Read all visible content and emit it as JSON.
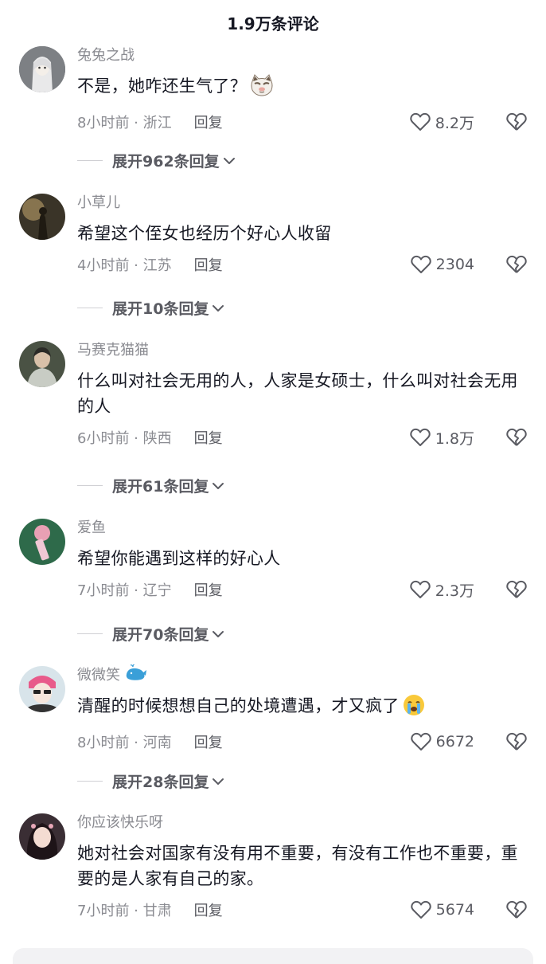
{
  "header": {
    "title": "1.9万条评论"
  },
  "comments": [
    {
      "username": "兔兔之战",
      "text": "不是，她咋还生气了？",
      "emoji": "cat-face-emoji",
      "time_location": "8小时前 · 浙江",
      "reply_label": "回复",
      "likes": "8.2万",
      "expand_label": "展开962条回复"
    },
    {
      "username": "小草儿",
      "text": "希望这个侄女也经历个好心人收留",
      "time_location": "4小时前 · 江苏",
      "reply_label": "回复",
      "likes": "2304",
      "expand_label": "展开10条回复"
    },
    {
      "username": "马赛克猫猫",
      "text": "什么叫对社会无用的人，人家是女硕士，什么叫对社会无用的人",
      "time_location": "6小时前 · 陕西",
      "reply_label": "回复",
      "likes": "1.8万",
      "expand_label": "展开61条回复"
    },
    {
      "username": "爱鱼",
      "text": "希望你能遇到这样的好心人",
      "time_location": "7小时前 · 辽宁",
      "reply_label": "回复",
      "likes": "2.3万",
      "expand_label": "展开70条回复"
    },
    {
      "username": "微微笑",
      "username_badge": "whale-icon",
      "text": "清醒的时候想想自己的处境遭遇，才又疯了",
      "emoji": "crying-face-emoji",
      "time_location": "8小时前 · 河南",
      "reply_label": "回复",
      "likes": "6672",
      "expand_label": "展开28条回复"
    },
    {
      "username": "你应该快乐呀",
      "text": "她对社会对国家有没有用不重要，有没有工作也不重要，重要的是人家有自己的家。",
      "time_location": "7小时前 · 甘肃",
      "reply_label": "回复",
      "likes": "5674"
    }
  ],
  "colors": {
    "text_primary": "#161823",
    "text_secondary": "#8a8b91",
    "action": "#5a5b62"
  }
}
